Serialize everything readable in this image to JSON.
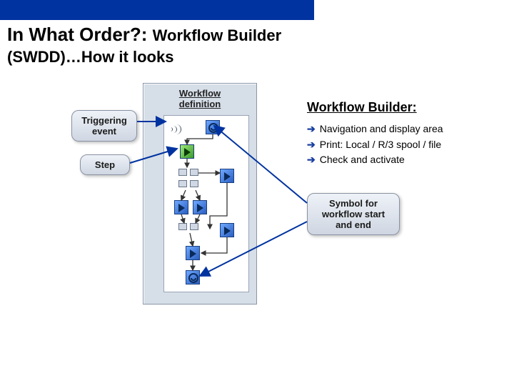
{
  "title": {
    "main": "In What Order?:",
    "sub1": "Workflow Builder",
    "sub2": "(SWDD)…How it looks"
  },
  "panel": {
    "heading_line1": "Workflow",
    "heading_line2": "definition"
  },
  "callouts": {
    "triggering_line1": "Triggering",
    "triggering_line2": "event",
    "step": "Step",
    "symbol_line1": "Symbol for",
    "symbol_line2": "workflow start",
    "symbol_line3": "and end"
  },
  "builder": {
    "heading": "Workflow Builder:",
    "items": [
      "Navigation and display area",
      "Print: Local / R/3 spool / file",
      "Check and activate"
    ]
  }
}
